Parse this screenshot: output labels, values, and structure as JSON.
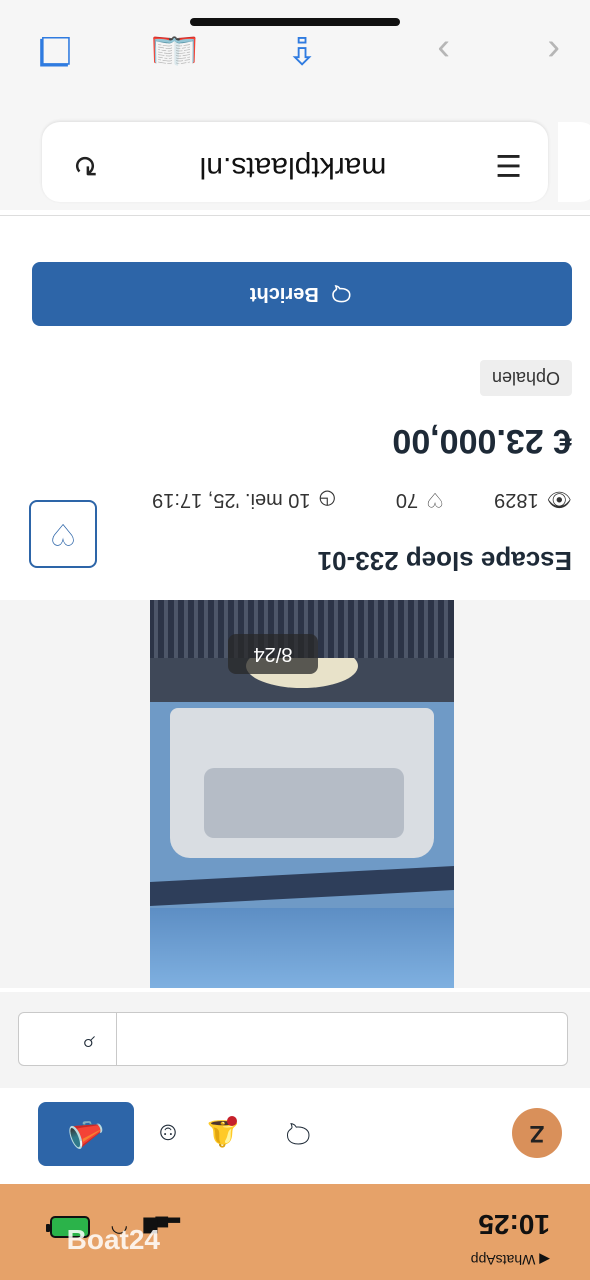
{
  "status_bar": {
    "time": "10:25",
    "back_app": "◀ WhatsApp"
  },
  "nav": {
    "avatar_letter": "Z"
  },
  "search": {
    "placeholder": ""
  },
  "listing": {
    "image_counter": "8/24",
    "title": "Escape sloep 233-01",
    "views": "1829",
    "favorites": "70",
    "date": "10 mei. '25, 17:19",
    "price": "€ 23.000,00",
    "delivery_tag": "Ophalen",
    "report_button": "Bericht"
  },
  "browser": {
    "url": "marktplaats.nl"
  },
  "watermark": {
    "text": "Boat24"
  },
  "colors": {
    "status_bg": "#e6a269",
    "primary_blue": "#2d65a8",
    "safari_blue": "#2f7be0",
    "notification_red": "#c6202b"
  }
}
